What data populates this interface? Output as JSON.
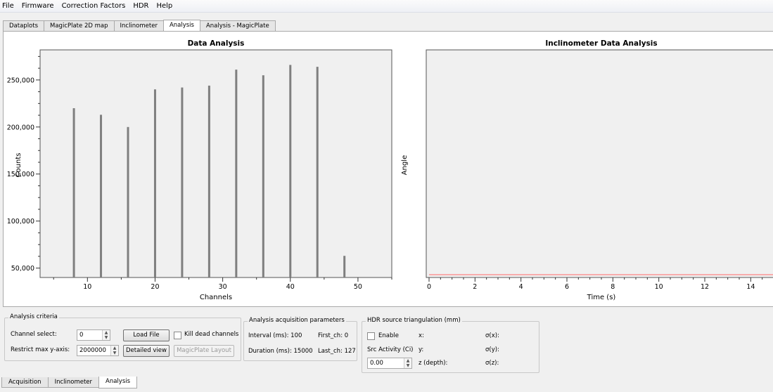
{
  "menu": [
    "File",
    "Firmware",
    "Correction Factors",
    "HDR",
    "Help"
  ],
  "top_tabs": [
    {
      "label": "Dataplots",
      "active": false
    },
    {
      "label": "MagicPlate 2D map",
      "active": false
    },
    {
      "label": "Inclinometer",
      "active": false
    },
    {
      "label": "Analysis",
      "active": true
    },
    {
      "label": "Analysis - MagicPlate",
      "active": false
    }
  ],
  "chart_data": [
    {
      "type": "bar",
      "title": "Data Analysis",
      "xlabel": "Channels",
      "ylabel": "Counts",
      "xlim": [
        3,
        55
      ],
      "ylim": [
        40000,
        282000
      ],
      "xticks": [
        10,
        20,
        30,
        40,
        50
      ],
      "yticks": [
        50000,
        100000,
        150000,
        200000,
        250000
      ],
      "ytick_labels": [
        "50,000",
        "100,000",
        "150,000",
        "200,000",
        "250,000"
      ],
      "grid": false,
      "bar_color": "#7f7f7f",
      "x": [
        8,
        12,
        16,
        20,
        24,
        28,
        32,
        36,
        40,
        44,
        48
      ],
      "values": [
        220000,
        213000,
        200000,
        240000,
        242000,
        244000,
        261000,
        255000,
        266000,
        264000,
        63000
      ]
    },
    {
      "type": "line",
      "title": "Inclinometer Data Analysis",
      "xlabel": "Time (s)",
      "ylabel": "Angle",
      "xlim": [
        0,
        15
      ],
      "xticks": [
        0,
        2,
        4,
        6,
        8,
        10,
        12,
        14
      ],
      "grid": false,
      "line_color": "#ff6666",
      "series": [
        {
          "x": [
            0,
            15
          ],
          "y": [
            0,
            0
          ]
        }
      ]
    }
  ],
  "analysis_criteria": {
    "title": "Analysis criteria",
    "channel_select_label": "Channel select:",
    "channel_select_value": "0",
    "restrict_label": "Restrict max y-axis:",
    "restrict_value": "2000000",
    "load_file": "Load File",
    "detailed_view": "Detailed view",
    "magicplate_layout": "MagicPlate Layout",
    "kill_dead_channels": "Kill dead channels"
  },
  "acq_params": {
    "title": "Analysis acquisition parameters",
    "interval": "Interval (ms):  100",
    "first_ch": "First_ch:  0",
    "duration": "Duration (ms):  15000",
    "last_ch": "Last_ch:  127"
  },
  "hdr": {
    "title": "HDR source triangulation (mm)",
    "enable": "Enable",
    "x": "x:",
    "sx": "σ(x):",
    "src_activity": "Src Activity (Ci)",
    "y": "y:",
    "sy": "σ(y):",
    "value": "0.00",
    "z": "z (depth):",
    "sz": "σ(z):"
  },
  "bottom_tabs": [
    {
      "label": "Acquisition",
      "active": false
    },
    {
      "label": "Inclinometer",
      "active": false
    },
    {
      "label": "Analysis",
      "active": true
    }
  ]
}
